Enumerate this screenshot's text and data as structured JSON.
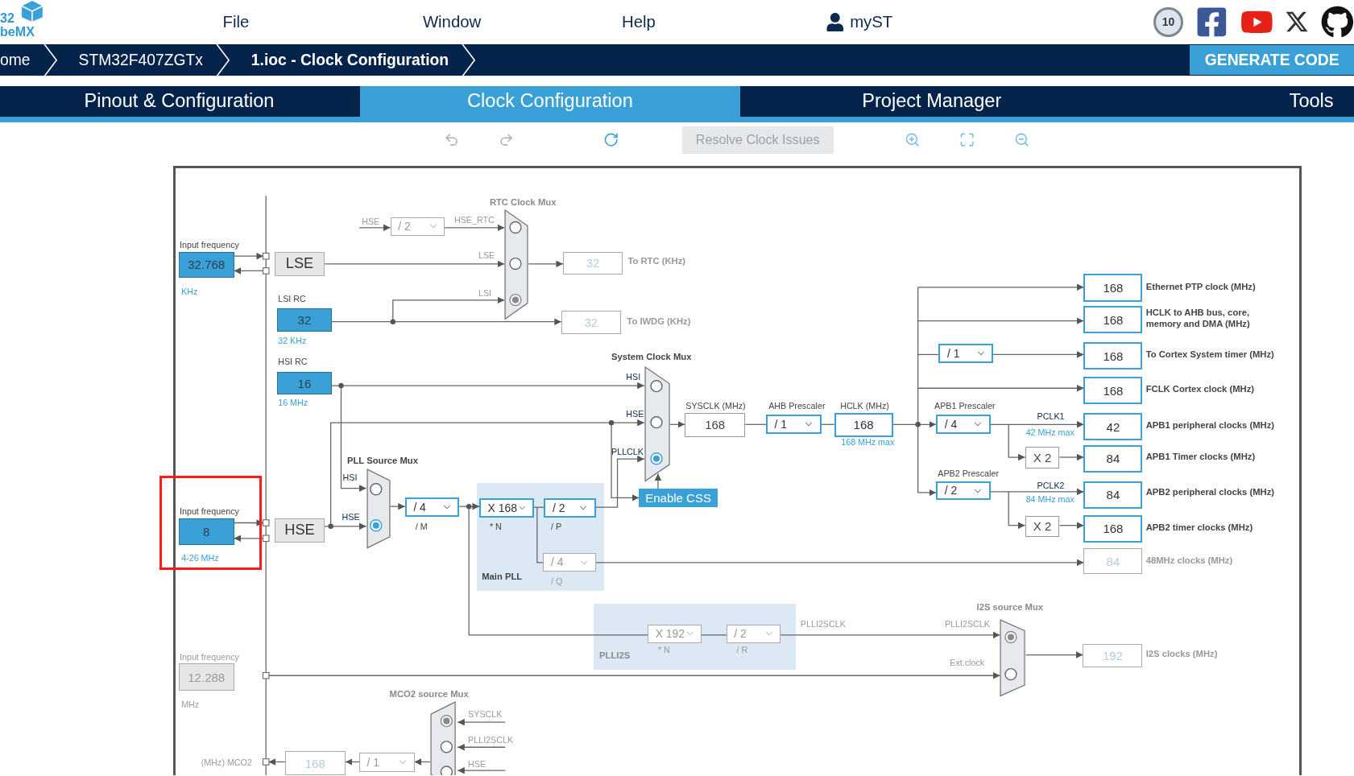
{
  "logo": [
    "32",
    "beMX"
  ],
  "menu": [
    "File",
    "Window",
    "Help"
  ],
  "user": "myST",
  "badge": "10",
  "breadcrumbs": [
    "ome",
    "STM32F407ZGTx",
    "1.ioc - Clock Configuration"
  ],
  "generate_button": "GENERATE CODE",
  "tabs": [
    {
      "label": "Pinout & Configuration",
      "selected": false
    },
    {
      "label": "Clock Configuration",
      "selected": true
    },
    {
      "label": "Project Manager",
      "selected": false
    },
    {
      "label": "Tools",
      "selected": false
    }
  ],
  "toolbar": {
    "resolve_button": "Resolve Clock Issues"
  },
  "nodes": [
    {
      "kind": "caption",
      "text": "Input frequency",
      "disabled": false
    },
    {
      "kind": "input",
      "text": "32.768",
      "disabled": false
    },
    {
      "kind": "note",
      "text": "KHz",
      "disabled": false
    },
    {
      "kind": "source",
      "text": "LSE"
    },
    {
      "kind": "caption",
      "text": "LSI RC",
      "disabled": false
    },
    {
      "kind": "input",
      "text": "32",
      "disabled": false
    },
    {
      "kind": "note",
      "text": "32 KHz",
      "disabled": false
    },
    {
      "kind": "caption",
      "text": "HSI RC",
      "disabled": false
    },
    {
      "kind": "input",
      "text": "16",
      "disabled": false
    },
    {
      "kind": "note",
      "text": "16 MHz",
      "disabled": false
    },
    {
      "kind": "caption",
      "text": "Input frequency",
      "disabled": false
    },
    {
      "kind": "input",
      "text": "8",
      "disabled": false
    },
    {
      "kind": "note",
      "text": "4-26 MHz",
      "disabled": false
    },
    {
      "kind": "source",
      "text": "HSE"
    },
    {
      "kind": "caption",
      "text": "Input frequency",
      "disabled": true
    },
    {
      "kind": "input",
      "text": "12.288",
      "disabled": true
    },
    {
      "kind": "caption",
      "text": "MHz",
      "disabled": true
    },
    {
      "kind": "caption",
      "text": "(MHz) MCO2",
      "disabled": true
    },
    {
      "kind": "output",
      "text": "168",
      "disabled": true
    },
    {
      "kind": "select",
      "text": "/ 1",
      "disabled": true
    },
    {
      "kind": "title",
      "text": "MCO2 source Mux",
      "disabled": true
    },
    {
      "kind": "caption",
      "text": "SYSCLK",
      "disabled": true
    },
    {
      "kind": "caption",
      "text": "PLLI2SCLK",
      "disabled": true
    },
    {
      "kind": "caption",
      "text": "HSE",
      "disabled": true
    },
    {
      "kind": "title",
      "text": "RTC Clock Mux",
      "disabled": true
    },
    {
      "kind": "caption",
      "text": "HSE",
      "disabled": true
    },
    {
      "kind": "select",
      "text": "/ 2",
      "disabled": true
    },
    {
      "kind": "caption",
      "text": "HSE_RTC",
      "disabled": true
    },
    {
      "kind": "caption",
      "text": "LSE",
      "disabled": true
    },
    {
      "kind": "caption",
      "text": "LSI",
      "disabled": true
    },
    {
      "kind": "output",
      "text": "32",
      "disabled": true
    },
    {
      "kind": "label",
      "text": "To RTC (KHz)",
      "disabled": true
    },
    {
      "kind": "output",
      "text": "32",
      "disabled": true
    },
    {
      "kind": "label",
      "text": "To IWDG (KHz)",
      "disabled": true
    },
    {
      "kind": "title",
      "text": "System Clock Mux",
      "disabled": false
    },
    {
      "kind": "signal",
      "text": "HSI",
      "disabled": false
    },
    {
      "kind": "signal",
      "text": "HSE",
      "disabled": false
    },
    {
      "kind": "signal",
      "text": "PLLCLK",
      "disabled": false
    },
    {
      "kind": "button",
      "text": "Enable CSS"
    },
    {
      "kind": "caption",
      "text": "SYSCLK (MHz)",
      "disabled": false
    },
    {
      "kind": "plain",
      "text": "168"
    },
    {
      "kind": "caption",
      "text": "AHB Prescaler",
      "disabled": false
    },
    {
      "kind": "select",
      "text": "/ 1",
      "disabled": false
    },
    {
      "kind": "caption",
      "text": "HCLK (MHz)",
      "disabled": false
    },
    {
      "kind": "output",
      "text": "168",
      "disabled": false
    },
    {
      "kind": "note",
      "text": "168 MHz max",
      "disabled": false
    },
    {
      "kind": "title",
      "text": "PLL Source Mux",
      "disabled": false
    },
    {
      "kind": "signal",
      "text": "HSI",
      "disabled": false
    },
    {
      "kind": "signal",
      "text": "HSE",
      "disabled": false
    },
    {
      "kind": "select",
      "text": "/ 4",
      "disabled": false
    },
    {
      "kind": "caption",
      "text": "/ M",
      "disabled": false
    },
    {
      "kind": "select",
      "text": "X 168",
      "disabled": false
    },
    {
      "kind": "caption",
      "text": "* N",
      "disabled": false
    },
    {
      "kind": "select",
      "text": "/ 2",
      "disabled": false
    },
    {
      "kind": "caption",
      "text": "/ P",
      "disabled": false
    },
    {
      "kind": "select",
      "text": "/ 4",
      "disabled": true
    },
    {
      "kind": "caption",
      "text": "/ Q",
      "disabled": true
    },
    {
      "kind": "title",
      "text": "Main PLL",
      "disabled": false
    },
    {
      "kind": "title",
      "text": "PLLI2S",
      "disabled": true
    },
    {
      "kind": "select",
      "text": "X 192",
      "disabled": true
    },
    {
      "kind": "caption",
      "text": "* N",
      "disabled": true
    },
    {
      "kind": "select",
      "text": "/ 2",
      "disabled": true
    },
    {
      "kind": "caption",
      "text": "/ R",
      "disabled": true
    },
    {
      "kind": "caption",
      "text": "PLLI2SCLK",
      "disabled": true
    },
    {
      "kind": "caption",
      "text": "PLLI2SCLK",
      "disabled": true
    },
    {
      "kind": "caption",
      "text": "Ext.clock",
      "disabled": true
    },
    {
      "kind": "title",
      "text": "I2S source Mux",
      "disabled": true
    },
    {
      "kind": "output",
      "text": "192",
      "disabled": true
    },
    {
      "kind": "label",
      "text": "I2S clocks (MHz)",
      "disabled": true
    },
    {
      "kind": "output",
      "text": "168",
      "disabled": false
    },
    {
      "kind": "label",
      "text": "Ethernet PTP clock (MHz)",
      "disabled": false
    },
    {
      "kind": "output",
      "text": "168",
      "disabled": false
    },
    {
      "kind": "label",
      "text": "HCLK to AHB bus, core, memory and DMA (MHz)",
      "disabled": false
    },
    {
      "kind": "output",
      "text": "168",
      "disabled": false
    },
    {
      "kind": "label",
      "text": "To Cortex System timer (MHz)",
      "disabled": false
    },
    {
      "kind": "output",
      "text": "168",
      "disabled": false
    },
    {
      "kind": "label",
      "text": "FCLK Cortex clock (MHz)",
      "disabled": false
    },
    {
      "kind": "select",
      "text": "/ 1",
      "disabled": false
    },
    {
      "kind": "caption",
      "text": "APB1 Prescaler",
      "disabled": false
    },
    {
      "kind": "select",
      "text": "/ 4",
      "disabled": false
    },
    {
      "kind": "signal",
      "text": "PCLK1",
      "disabled": false
    },
    {
      "kind": "note",
      "text": "42 MHz max",
      "disabled": false
    },
    {
      "kind": "output",
      "text": "42",
      "disabled": false
    },
    {
      "kind": "label",
      "text": "APB1 peripheral clocks (MHz)",
      "disabled": false
    },
    {
      "kind": "plain",
      "text": "X 2"
    },
    {
      "kind": "output",
      "text": "84",
      "disabled": false
    },
    {
      "kind": "label",
      "text": "APB1 Timer clocks (MHz)",
      "disabled": false
    },
    {
      "kind": "caption",
      "text": "APB2 Prescaler",
      "disabled": false
    },
    {
      "kind": "select",
      "text": "/ 2",
      "disabled": false
    },
    {
      "kind": "signal",
      "text": "PCLK2",
      "disabled": false
    },
    {
      "kind": "note",
      "text": "84 MHz max",
      "disabled": false
    },
    {
      "kind": "output",
      "text": "84",
      "disabled": false
    },
    {
      "kind": "label",
      "text": "APB2 peripheral clocks (MHz)",
      "disabled": false
    },
    {
      "kind": "plain",
      "text": "X 2"
    },
    {
      "kind": "output",
      "text": "168",
      "disabled": false
    },
    {
      "kind": "label",
      "text": "APB2 timer clocks (MHz)",
      "disabled": false
    },
    {
      "kind": "output",
      "text": "84",
      "disabled": true
    },
    {
      "kind": "label",
      "text": "48MHz clocks (MHz)",
      "disabled": true
    },
    {
      "kind": "highlight"
    }
  ],
  "muxes": [
    {
      "disabled": true,
      "options": [
        {
          "selected": false
        },
        {
          "selected": false
        },
        {
          "selected": true
        }
      ]
    },
    {
      "disabled": false,
      "options": [
        {
          "selected": false
        },
        {
          "selected": false
        },
        {
          "selected": true
        }
      ]
    },
    {
      "disabled": false,
      "options": [
        {
          "selected": false
        },
        {
          "selected": true
        }
      ]
    },
    {
      "disabled": true,
      "options": [
        {
          "selected": true
        },
        {
          "selected": false
        }
      ]
    },
    {
      "disabled": true,
      "options": [
        {
          "selected": true
        },
        {
          "selected": false
        },
        {
          "selected": false
        }
      ]
    }
  ]
}
